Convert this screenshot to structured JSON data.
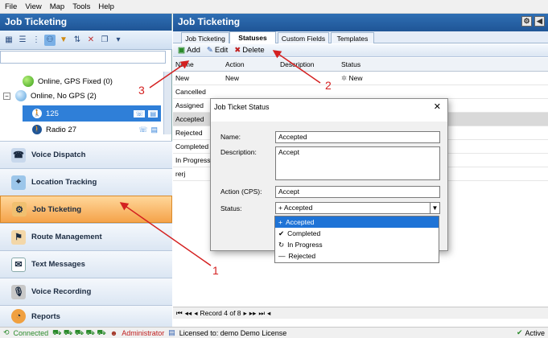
{
  "menu": [
    "File",
    "View",
    "Map",
    "Tools",
    "Help"
  ],
  "left_panel": {
    "title": "Job Ticketing",
    "tree": [
      {
        "label": "Online, GPS Fixed (0)",
        "status": "green"
      },
      {
        "label": "Online, No GPS (2)",
        "status": "blue"
      },
      {
        "label": "125",
        "selected": true
      },
      {
        "label": "Radio 27"
      }
    ],
    "nav": [
      {
        "label": "Voice Dispatch",
        "icon": "radio-icon"
      },
      {
        "label": "Location Tracking",
        "icon": "map-icon"
      },
      {
        "label": "Job Ticketing",
        "icon": "job-icon",
        "active": true
      },
      {
        "label": "Route Management",
        "icon": "route-icon"
      },
      {
        "label": "Text Messages",
        "icon": "envelope-icon"
      },
      {
        "label": "Voice Recording",
        "icon": "microphone-icon"
      },
      {
        "label": "Reports",
        "icon": "reports-icon"
      }
    ]
  },
  "right_panel": {
    "title": "Job Ticketing",
    "tabs": [
      "Job Ticketing",
      "Statuses",
      "Custom Fields",
      "Templates"
    ],
    "active_tab": "Statuses",
    "toolbar": {
      "add": "Add",
      "edit": "Edit",
      "delete": "Delete"
    },
    "columns": [
      "Name",
      "Action",
      "Description",
      "Status"
    ],
    "rows": [
      {
        "name": "New",
        "action": "New",
        "description": "",
        "status": "New"
      },
      {
        "name": "Cancelled",
        "action": "",
        "description": "",
        "status": ""
      },
      {
        "name": "Assigned",
        "action": "",
        "description": "",
        "status": ""
      },
      {
        "name": "Accepted",
        "action": "",
        "description": "",
        "status": ""
      },
      {
        "name": "Rejected",
        "action": "",
        "description": "",
        "status": ""
      },
      {
        "name": "Completed",
        "action": "",
        "description": "",
        "status": ""
      },
      {
        "name": "In Progress",
        "action": "",
        "description": "",
        "status": ""
      },
      {
        "name": "rerj",
        "action": "",
        "description": "",
        "status": ""
      }
    ],
    "pager": {
      "text": "Record 4 of 8"
    }
  },
  "dialog": {
    "title": "Job Ticket Status",
    "name_label": "Name:",
    "name_value": "Accepted",
    "description_label": "Description:",
    "description_value": "Accept",
    "action_label": "Action (CPS):",
    "action_value": "Accept",
    "status_label": "Status:",
    "status_value": "Accepted",
    "options": [
      {
        "label": "Accepted",
        "icon": "+",
        "selected": true
      },
      {
        "label": "Completed",
        "icon": "✔"
      },
      {
        "label": "In Progress",
        "icon": "↻"
      },
      {
        "label": "Rejected",
        "icon": "—"
      }
    ]
  },
  "status_bar": {
    "connected": "Connected",
    "user": "Administrator",
    "license": "Licensed to: demo Demo License",
    "right": "Active"
  },
  "annotations": [
    "1",
    "2",
    "3"
  ],
  "colors": {
    "accent": "#d42020",
    "header": "#1f5596",
    "active_nav": "#f5a34a",
    "selection": "#1e73d6"
  }
}
